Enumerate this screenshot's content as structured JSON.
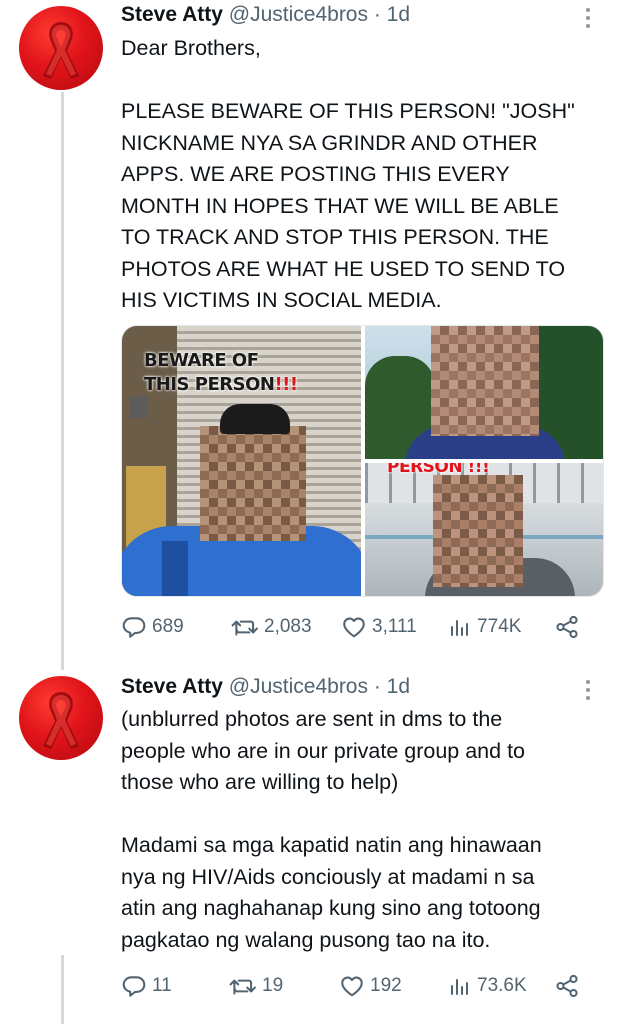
{
  "tweets": [
    {
      "author_name": "Steve Atty",
      "handle_time": "@Justice4bros · 1d",
      "paragraphs": [
        [
          "Dear Brothers,"
        ],
        [
          "PLEASE BEWARE OF THIS PERSON! \"JOSH\"",
          "NICKNAME NYA SA GRINDR AND OTHER",
          "APPS. WE ARE POSTING THIS EVERY",
          "MONTH IN HOPES THAT WE WILL BE ABLE",
          "TO TRACK AND STOP THIS PERSON. THE",
          "PHOTOS ARE WHAT HE USED TO SEND TO",
          "HIS VICTIMS IN SOCIAL MEDIA."
        ]
      ],
      "media": {
        "photo1_caption": [
          "BEWARE OF",
          "THIS PERSON",
          "!!!"
        ],
        "photo3_caption": "PERSON !!!"
      },
      "stats": {
        "replies": "689",
        "retweets": "2,083",
        "likes": "3,111",
        "views": "774K"
      }
    },
    {
      "author_name": "Steve Atty",
      "handle_time": "@Justice4bros · 1d",
      "paragraphs": [
        [
          "(unblurred photos are sent in dms to the",
          "people who are in our private group and to",
          "those who are willing to help)"
        ],
        [
          "Madami sa mga kapatid natin ang hinawaan",
          "nya ng HIV/Aids conciously at madami n sa",
          "atin ang naghahanap kung sino ang totoong",
          "pagkatao ng walang pusong tao na ito."
        ]
      ],
      "stats": {
        "replies": "11",
        "retweets": "19",
        "likes": "192",
        "views": "73.6K"
      }
    }
  ],
  "icons": {
    "avatar": "red-ribbon-icon",
    "more": "more-dots-icon",
    "reply": "reply-icon",
    "retweet": "retweet-icon",
    "like": "heart-icon",
    "views": "views-chart-icon",
    "share": "share-icon"
  },
  "colors": {
    "text": "#0f1419",
    "muted": "#536471",
    "thread_line": "#cfd9de",
    "avatar_red": "#e0141a"
  }
}
